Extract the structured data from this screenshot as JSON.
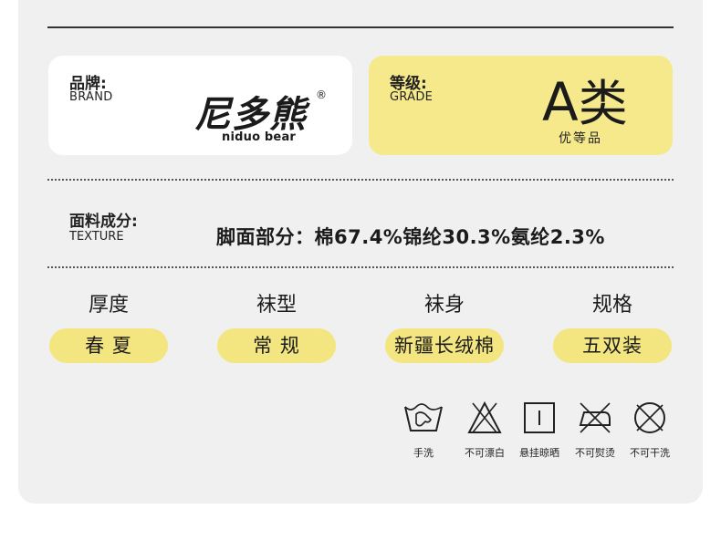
{
  "brand": {
    "label_cn": "品牌:",
    "label_en": "BRAND",
    "logo_cn": "尼多熊",
    "logo_reg": "®",
    "logo_en": "niduo bear"
  },
  "grade": {
    "label_cn": "等级:",
    "label_en": "GRADE",
    "value_letter": "A",
    "value_cn": "类",
    "sub": "优等品"
  },
  "texture": {
    "label_cn": "面料成分:",
    "label_en": "TEXTURE",
    "value": "脚面部分：棉67.4%锦纶30.3%氨纶2.3%"
  },
  "attributes": [
    {
      "head": "厚度",
      "value": "春 夏"
    },
    {
      "head": "袜型",
      "value": "常 规"
    },
    {
      "head": "袜身",
      "value": "新疆长绒棉"
    },
    {
      "head": "规格",
      "value": "五双装"
    }
  ],
  "care": [
    {
      "icon": "hand-wash-icon",
      "label": "手洗"
    },
    {
      "icon": "no-bleach-icon",
      "label": "不可漂白"
    },
    {
      "icon": "hang-dry-icon",
      "label": "悬挂晾晒"
    },
    {
      "icon": "no-iron-icon",
      "label": "不可熨烫"
    },
    {
      "icon": "no-dry-clean-icon",
      "label": "不可干洗"
    }
  ],
  "colors": {
    "panel": "#f0f0f0",
    "accent_yellow": "#f5e98c",
    "pill_yellow": "#f3e57f",
    "text": "#1b1b1b"
  }
}
